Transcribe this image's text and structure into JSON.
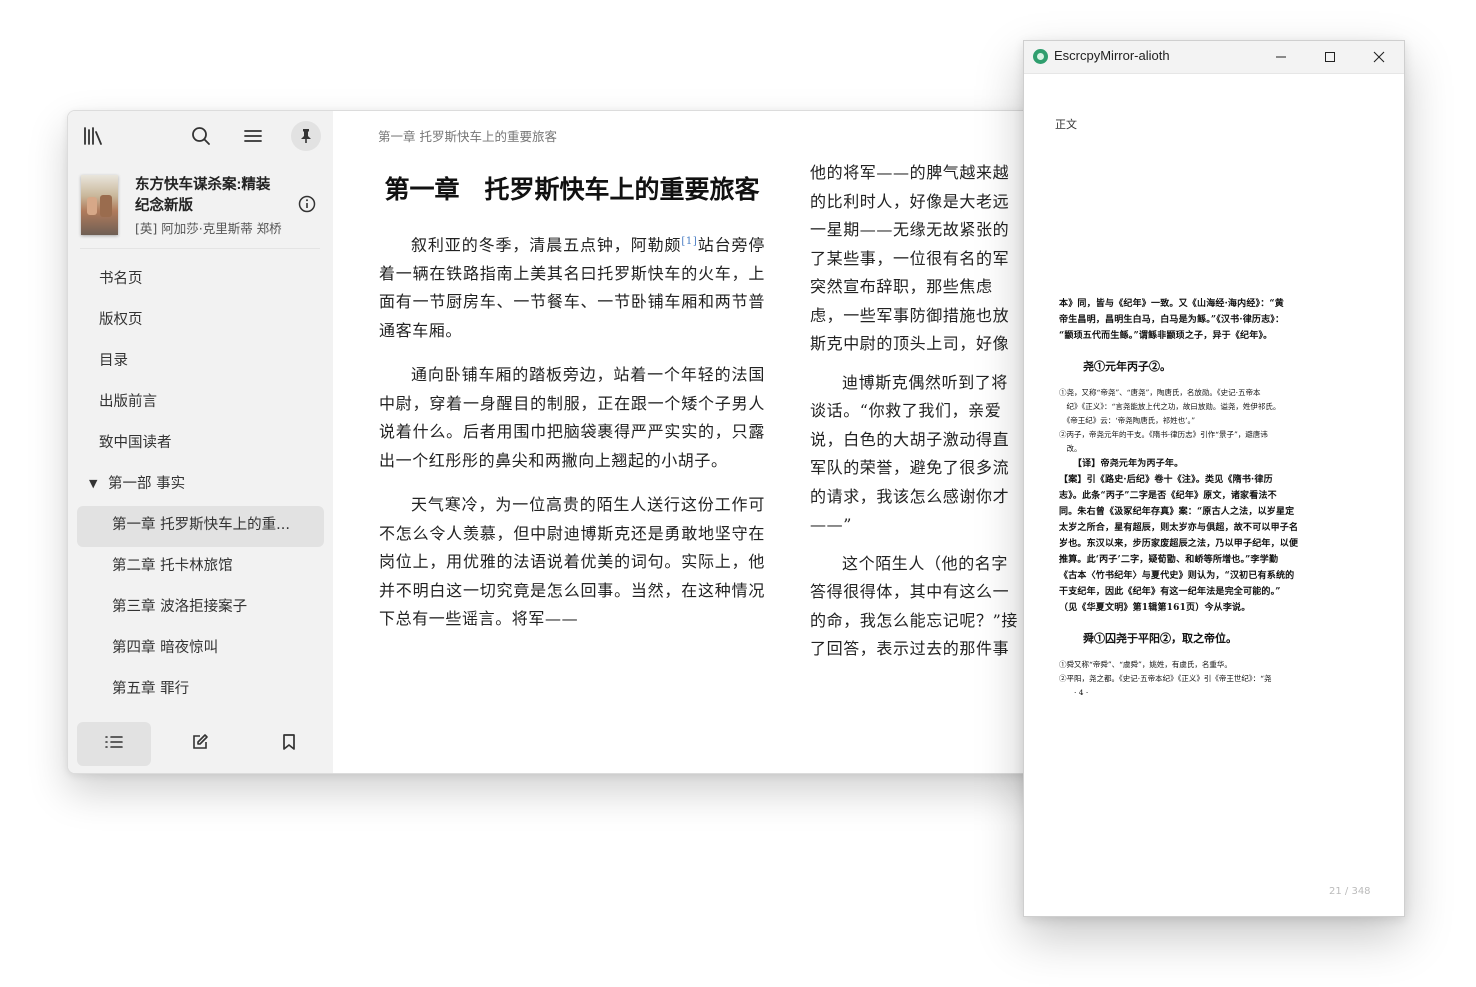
{
  "reader": {
    "toolbar": {
      "library_icon": "library-icon",
      "search_icon": "search-icon",
      "menu_icon": "menu-icon",
      "pin_icon": "pin-icon"
    },
    "book": {
      "title": "东方快车谋杀案:精装纪念新版",
      "author": "[英] 阿加莎·克里斯蒂 郑桥"
    },
    "toc": [
      {
        "label": "书名页",
        "level": 0
      },
      {
        "label": "版权页",
        "level": 0
      },
      {
        "label": "目录",
        "level": 0
      },
      {
        "label": "出版前言",
        "level": 0
      },
      {
        "label": "致中国读者",
        "level": 0
      },
      {
        "label": "第一部 事实",
        "level": 0,
        "expanded": true
      },
      {
        "label": "第一章 托罗斯快车上的重...",
        "level": 1,
        "active": true
      },
      {
        "label": "第二章 托卡林旅馆",
        "level": 1
      },
      {
        "label": "第三章 波洛拒接案子",
        "level": 1
      },
      {
        "label": "第四章 暗夜惊叫",
        "level": 1
      },
      {
        "label": "第五章 罪行",
        "level": 1
      }
    ],
    "bottom_tabs": {
      "toc": "list-icon",
      "notes": "edit-icon",
      "bookmarks": "bookmark-icon"
    },
    "content": {
      "running_head": "第一章 托罗斯快车上的重要旅客",
      "chapter_title": "第一章　托罗斯快车上的重要旅客",
      "p1_a": "叙利亚的冬季，清晨五点钟，阿勒颇",
      "p1_note": "[1]",
      "p1_b": "站台旁停着一辆在铁路指南上美其名曰托罗斯快车的火车，上面有一节厨房车、一节餐车、一节卧铺车厢和两节普通客车厢。",
      "p2": "通向卧铺车厢的踏板旁边，站着一个年轻的法国中尉，穿着一身醒目的制服，正在跟一个矮个子男人说着什么。后者用围巾把脑袋裹得严严实实的，只露出一个红彤彤的鼻尖和两撇向上翘起的小胡子。",
      "p3": "天气寒冷，为一位高贵的陌生人送行这份工作可不怎么令人羡慕，但中尉迪博斯克还是勇敢地坚守在岗位上，用优雅的法语说着优美的词句。实际上，他并不明白这一切究竟是怎么回事。当然，在这种情况下总有一些谣言。将军——",
      "col2": [
        "他的将军——的脾气越来越",
        "的比利时人，好像是大老远",
        "一星期——无缘无故紧张的",
        "了某些事，一位很有名的军",
        "突然宣布辞职，那些焦虑",
        "虑，一些军事防御措施也放",
        "斯克中尉的顶头上司，好像",
        "",
        "迪博斯克偶然听到了将",
        "谈话。“你救了我们，亲爱",
        "说，白色的大胡子激动得直",
        "军队的荣誉，避免了很多流",
        "的请求，我该怎么感谢你才",
        "——”",
        "",
        "这个陌生人（他的名字",
        "答得很得体，其中有这么一",
        "的命，我怎么能忘记呢？”接",
        "了回答，表示过去的那件事"
      ]
    }
  },
  "mirror": {
    "window_title": "EscrcpyMirror-alioth",
    "controls": {
      "minimize": "minimize-icon",
      "maximize": "maximize-icon",
      "close": "close-icon"
    },
    "page_label": "正文",
    "scan_lines": [
      {
        "t": "s",
        "text": "本》同，皆与《纪年》一致。又《山海经·海内经》：“黄"
      },
      {
        "t": "s",
        "text": "帝生昌明，昌明生白马，白马是为鲧。”《汉书·律历志》："
      },
      {
        "t": "s",
        "text": "“颛顼五代而生鲧。”谓鲧非颛顼之子，异于《纪年》。"
      },
      {
        "t": "gap"
      },
      {
        "t": "h",
        "text": "尧①元年丙子②。"
      },
      {
        "t": "gap2"
      },
      {
        "t": "fn",
        "text": "①尧，又称“帝尧”、“唐尧”，陶唐氏，名放勋。《史记·五帝本"
      },
      {
        "t": "fn",
        "text": "　纪》《正义》：“言尧能放上代之功，故曰放勋。谥尧，姓伊祁氏。"
      },
      {
        "t": "fn",
        "text": "　《帝王纪》云：‘帝尧陶唐氏，祁姓也’。”"
      },
      {
        "t": "fn",
        "text": "②丙子，帝尧元年的干支。《隋书·律历志》引作“景子”，避唐讳"
      },
      {
        "t": "fn",
        "text": "　改。"
      },
      {
        "t": "s",
        "text": "　　【译】帝尧元年为丙子年。"
      },
      {
        "t": "s",
        "text": "【案】引《路史·后纪》卷十《注》。类见《隋书·律历"
      },
      {
        "t": "s",
        "text": "志》。此条“丙子”二字是否《纪年》原文，诸家看法不"
      },
      {
        "t": "s",
        "text": "同。朱右曾《汲冢纪年存真》案：“原古人之法，以岁星定"
      },
      {
        "t": "s",
        "text": "太岁之所合，星有超辰，则太岁亦与俱超，故不可以甲子名"
      },
      {
        "t": "s",
        "text": "岁也。东汉以来，步历家废超辰之法，乃以甲子纪年，以便"
      },
      {
        "t": "s",
        "text": "推算。此‘丙子’二字，疑荀勖、和峤等所增也。”李学勤"
      },
      {
        "t": "s",
        "text": "《古本〈竹书纪年〉与夏代史》则认为，“汉初已有系统的"
      },
      {
        "t": "s",
        "text": "干支纪年，因此《纪年》有这一纪年法是完全可能的。”"
      },
      {
        "t": "s",
        "text": "（见《华夏文明》第1辑第161页）今从李说。"
      },
      {
        "t": "gap"
      },
      {
        "t": "h",
        "text": "舜①囚尧于平阳②，取之帝位。"
      },
      {
        "t": "gap2"
      },
      {
        "t": "fn",
        "text": "①舜又称“帝舜”、“虞舜”，姚姓，有虞氏，名重华。"
      },
      {
        "t": "fn",
        "text": "②平阳，尧之都。《史记·五帝本纪》《正义》引《帝王世纪》：“尧"
      },
      {
        "t": "fn",
        "text": "　　· 4 ·"
      }
    ],
    "page_number": "21 / 348"
  }
}
